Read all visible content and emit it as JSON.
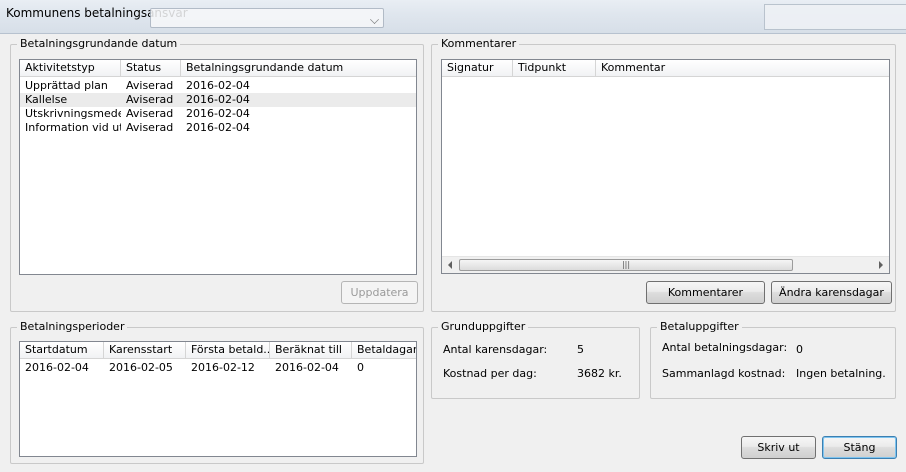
{
  "window": {
    "title": "Kommunens betalningsansvar"
  },
  "betalningsgrundande": {
    "legend": "Betalningsgrundande datum",
    "columns": [
      "Aktivitetstyp",
      "Status",
      "Betalningsgrundande datum"
    ],
    "rows": [
      [
        "Upprättad plan",
        "Aviserad",
        "2016-02-04"
      ],
      [
        "Kallelse",
        "Aviserad",
        "2016-02-04"
      ],
      [
        "Utskrivningsmede...",
        "Aviserad",
        "2016-02-04"
      ],
      [
        "Information vid ut...",
        "Aviserad",
        "2016-02-04"
      ]
    ],
    "update_button": "Uppdatera"
  },
  "kommentarer": {
    "legend": "Kommentarer",
    "columns": [
      "Signatur",
      "Tidpunkt",
      "Kommentar"
    ],
    "scroll_grip": "|||",
    "comment_button": "Kommentarer",
    "change_button": "Ändra karensdagar"
  },
  "betalningsperioder": {
    "legend": "Betalningsperioder",
    "columns": [
      "Startdatum",
      "Karensstart",
      "Första betald...",
      "Beräknat till",
      "Betaldagar"
    ],
    "rows": [
      [
        "2016-02-04",
        "2016-02-05",
        "2016-02-12",
        "2016-02-04",
        "0"
      ]
    ]
  },
  "grunduppgifter": {
    "legend": "Grunduppgifter",
    "karens_label": "Antal karensdagar:",
    "karens_value": "5",
    "kostnad_label": "Kostnad per dag:",
    "kostnad_value": "3682 kr."
  },
  "betaluppgifter": {
    "legend": "Betaluppgifter",
    "dagar_label": "Antal betalningsdagar:",
    "dagar_value": "0",
    "kostnad_label": "Sammanlagd kostnad:",
    "kostnad_value": "Ingen betalning."
  },
  "footer": {
    "print_button": "Skriv ut",
    "close_button": "Stäng"
  }
}
